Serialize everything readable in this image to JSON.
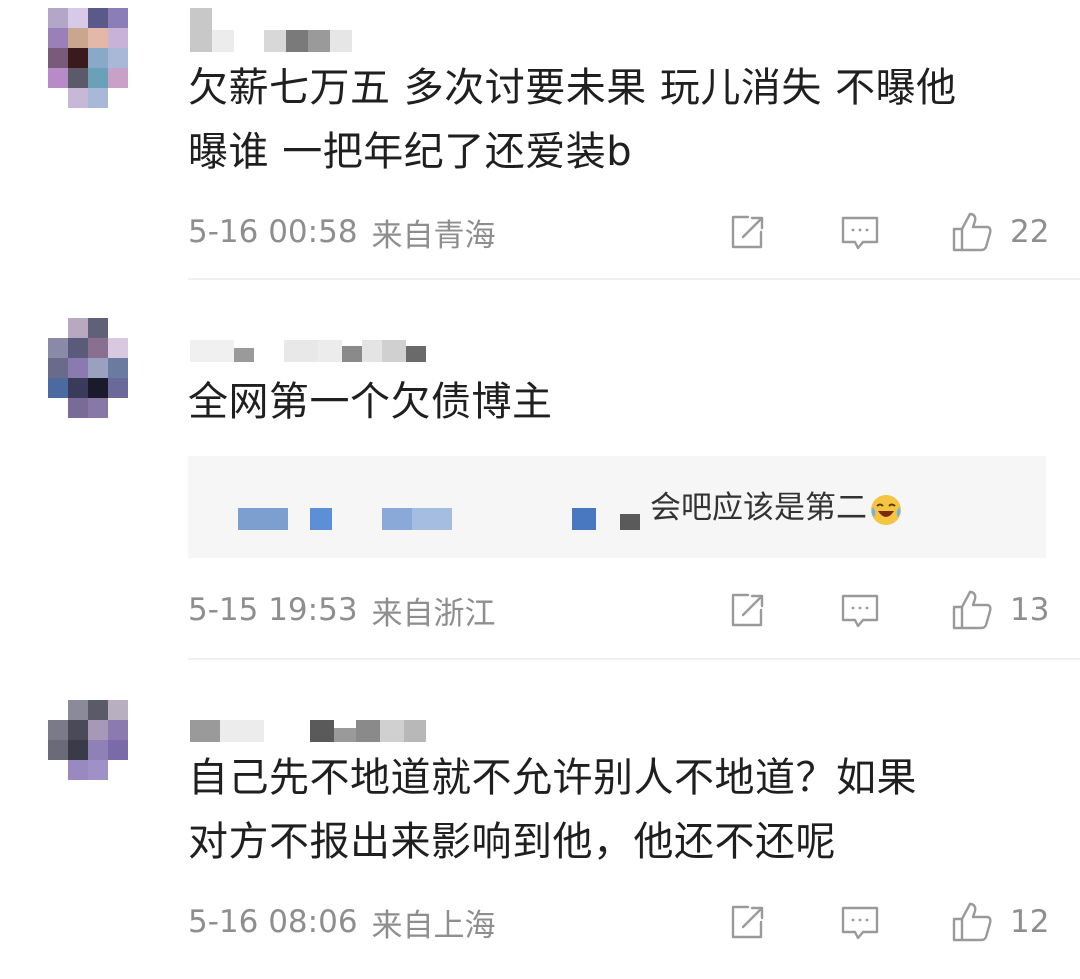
{
  "comments": [
    {
      "text": "欠薪七万五 多次讨要未果 玩儿消失 不曝他\n曝谁 一把年纪了还爱装b",
      "time": "5-16 00:58",
      "location": "来自青海",
      "likes": "22"
    },
    {
      "text": "全网第一个欠债博主",
      "reply_text": "会吧应该是第二",
      "time": "5-15 19:53",
      "location": "来自浙江",
      "likes": "13"
    },
    {
      "text": "自己先不地道就不允许别人不地道？如果\n对方不报出来影响到他，他还不还呢",
      "time": "5-16 08:06",
      "location": "来自上海",
      "likes": "12"
    }
  ],
  "icons": {
    "share": "share-icon",
    "reply": "comment-icon",
    "like": "thumbs-up-icon",
    "emoji": "laughing-tears-emoji"
  },
  "colors": {
    "text": "#1f1f1f",
    "meta": "#8e8e8e",
    "divider": "#f0f0f0",
    "reply_bg": "#f6f6f6",
    "mention": "#5b8fd6"
  }
}
